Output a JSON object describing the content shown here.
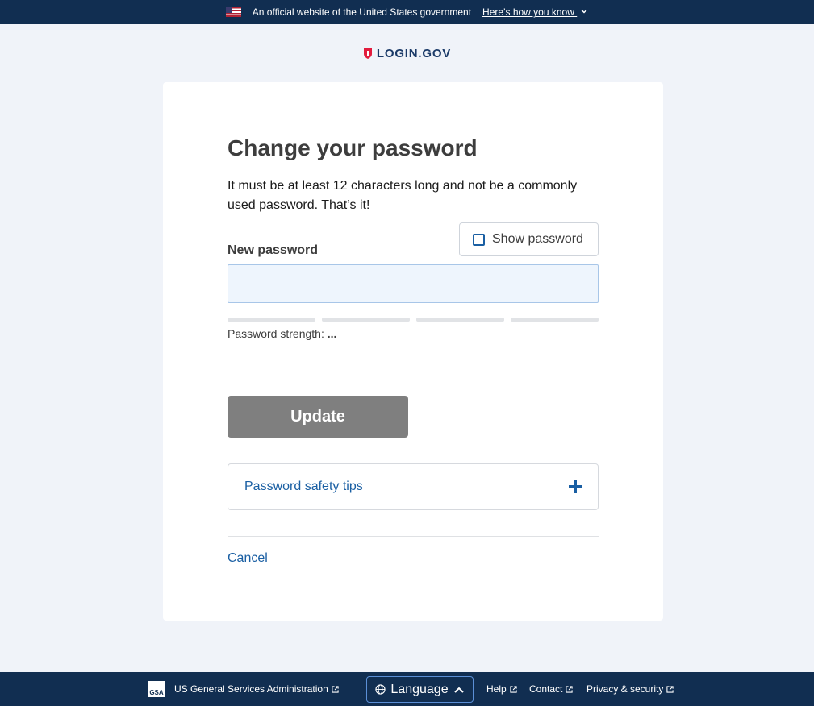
{
  "banner": {
    "text": "An official website of the United States government",
    "link": "Here’s how you know"
  },
  "logo": {
    "text": "LOGIN.GOV"
  },
  "page": {
    "title": "Change your password",
    "intro": "It must be at least 12 characters long and not be a commonly used password. That’s it!",
    "show_password": "Show password",
    "new_password_label": "New password",
    "new_password_value": "",
    "strength_label": "Password strength:",
    "strength_value": "...",
    "update_button": "Update",
    "tips_label": "Password safety tips",
    "cancel": "Cancel"
  },
  "footer": {
    "gsa_logo": "GSA",
    "gsa": "US General Services Administration",
    "language": "Language",
    "help": "Help",
    "contact": "Contact",
    "privacy": "Privacy & security"
  },
  "colors": {
    "banner_bg": "#112e51",
    "accent": "#1a5fa3",
    "disabled_button": "#7f7f7f",
    "page_bg": "#f0f3f9"
  },
  "icons": [
    "us-flag-icon",
    "chevron-down-icon",
    "shield-icon",
    "checkbox-icon",
    "plus-icon",
    "gsa-logo",
    "globe-icon",
    "chevron-up-icon",
    "external-link-icon"
  ]
}
